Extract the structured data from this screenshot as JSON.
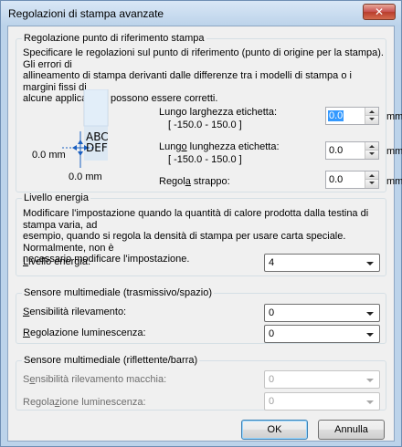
{
  "window": {
    "title": "Regolazioni di stampa avanzate",
    "close_label": "✕"
  },
  "reference": {
    "title": "Regolazione punto di riferimento stampa",
    "description_lines": [
      "Specificare le regolazioni sul punto di riferimento (punto di origine per la stampa). Gli errori di",
      "allineamento di stampa derivanti dalle differenze tra i modelli di stampa o i margini fissi di",
      "alcune applicazioni possono essere corretti."
    ],
    "preview": {
      "line1": "ABC",
      "line2": "DEF",
      "left_mm": "0.0 mm",
      "bottom_mm": "0.0 mm"
    },
    "width_label_pre": "Lungo larghezza etichetta:",
    "width_range": "[ -150.0 - 150.0 ]",
    "width_value": "0.0",
    "length_label_pre": "Lung",
    "length_label_u": "o",
    "length_label_post": " lunghezza etichetta:",
    "length_range": "[ -150.0 - 150.0 ]",
    "length_value": "0.0",
    "tear_label_pre": "Regol",
    "tear_label_u": "a",
    "tear_label_post": " strappo:",
    "tear_value": "0.0",
    "unit": "mm"
  },
  "energy": {
    "title": "Livello energia",
    "description_lines": [
      "Modificare l'impostazione quando la quantità di calore prodotta dalla testina di stampa varia, ad",
      "esempio, quando si regola la densità di stampa per usare carta speciale. Normalmente, non è",
      "necessario modificare l'impostazione."
    ],
    "label_u": "L",
    "label_post": "ivello energia:",
    "value": "4"
  },
  "sensor_trans": {
    "title": "Sensore multimediale (trasmissivo/spazio)",
    "sens_label_u": "S",
    "sens_label_post": "ensibilità rilevamento:",
    "sens_value": "0",
    "lum_label_u": "R",
    "lum_label_post": "egolazione luminescenza:",
    "lum_value": "0"
  },
  "sensor_refl": {
    "title": "Sensore multimediale (riflettente/barra)",
    "sens_label_pre": "S",
    "sens_label_u": "e",
    "sens_label_post": "nsibilità rilevamento macchia:",
    "sens_value": "0",
    "lum_label_pre": "Regola",
    "lum_label_u": "z",
    "lum_label_post": "ione luminescenza:",
    "lum_value": "0"
  },
  "buttons": {
    "ok": "OK",
    "cancel": "Annulla"
  }
}
